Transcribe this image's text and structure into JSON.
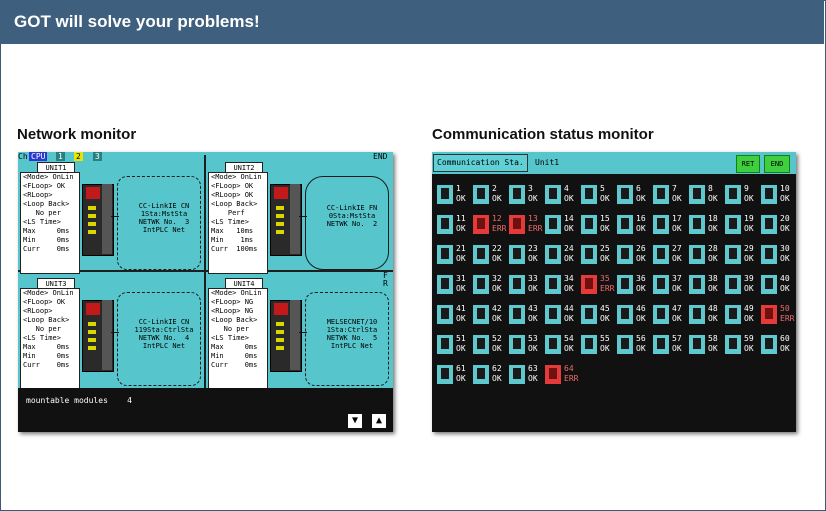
{
  "header": {
    "title": "GOT will solve your problems!"
  },
  "captions": {
    "network": "Network monitor",
    "comm": "Communication status monitor"
  },
  "network_monitor": {
    "top_bar": {
      "ch": "Ch",
      "cpu": "CPU",
      "tabs": [
        "1",
        "2",
        "3"
      ],
      "end": "END"
    },
    "units": [
      {
        "name": "UNIT1",
        "status": [
          "<Mode> OnLin",
          "<FLoop> OK",
          "<RLoop>",
          "<Loop Back>",
          "   No per",
          "<LS Time>",
          "Max     0ms",
          "Min     0ms",
          "Curr    0ms"
        ],
        "net": "CC-LinkIE CN\n1Sta:MstSta\nNETWK No.  3\nIntPLC Net"
      },
      {
        "name": "UNIT2",
        "status": [
          "<Mode> OnLin",
          "<FLoop> OK",
          "<RLoop> OK",
          "<Loop Back>",
          "    Perf",
          "<LS Time>",
          "Max   10ms",
          "Min    1ms",
          "Curr  100ms"
        ],
        "net": "CC-LinkIE FN\n0Sta:MstSta\nNETWK No.  2"
      },
      {
        "name": "UNIT3",
        "status": [
          "<Mode> OnLin",
          "<FLoop> OK",
          "<RLoop>",
          "<Loop Back>",
          "   No per",
          "<LS Time>",
          "Max     0ms",
          "Min     0ms",
          "Curr    0ms"
        ],
        "net": "CC-LinkIE CN\n119Sta:CtrlSta\nNETWK No.  4\nIntPLC Net"
      },
      {
        "name": "UNIT4",
        "status": [
          "<Mode> OnLin",
          "<FLoop> NG",
          "<RLoop> NG",
          "<Loop Back>",
          "   No per",
          "<LS Time>",
          "Max     0ms",
          "Min     0ms",
          "Curr    0ms"
        ],
        "net": "MELSECNET/10\n1Sta:CtrlSta\nNETWK No.  5\nIntPLC Net",
        "flags": "F\nR"
      }
    ],
    "footer": {
      "mountable": "mountable modules    4",
      "down": "▼",
      "up": "▲"
    }
  },
  "comm_monitor": {
    "title": "Communication Sta.",
    "unit": "Unit1",
    "ret": "RET",
    "end": "END",
    "stations": [
      {
        "n": "1",
        "s": "OK"
      },
      {
        "n": "2",
        "s": "OK"
      },
      {
        "n": "3",
        "s": "OK"
      },
      {
        "n": "4",
        "s": "OK"
      },
      {
        "n": "5",
        "s": "OK"
      },
      {
        "n": "6",
        "s": "OK"
      },
      {
        "n": "7",
        "s": "OK"
      },
      {
        "n": "8",
        "s": "OK"
      },
      {
        "n": "9",
        "s": "OK"
      },
      {
        "n": "10",
        "s": "OK"
      },
      {
        "n": "11",
        "s": "OK"
      },
      {
        "n": "12",
        "s": "ERR"
      },
      {
        "n": "13",
        "s": "ERR"
      },
      {
        "n": "14",
        "s": "OK"
      },
      {
        "n": "15",
        "s": "OK"
      },
      {
        "n": "16",
        "s": "OK"
      },
      {
        "n": "17",
        "s": "OK"
      },
      {
        "n": "18",
        "s": "OK"
      },
      {
        "n": "19",
        "s": "OK"
      },
      {
        "n": "20",
        "s": "OK"
      },
      {
        "n": "21",
        "s": "OK"
      },
      {
        "n": "22",
        "s": "OK"
      },
      {
        "n": "23",
        "s": "OK"
      },
      {
        "n": "24",
        "s": "OK"
      },
      {
        "n": "25",
        "s": "OK"
      },
      {
        "n": "26",
        "s": "OK"
      },
      {
        "n": "27",
        "s": "OK"
      },
      {
        "n": "28",
        "s": "OK"
      },
      {
        "n": "29",
        "s": "OK"
      },
      {
        "n": "30",
        "s": "OK"
      },
      {
        "n": "31",
        "s": "OK"
      },
      {
        "n": "32",
        "s": "OK"
      },
      {
        "n": "33",
        "s": "OK"
      },
      {
        "n": "34",
        "s": "OK"
      },
      {
        "n": "35",
        "s": "ERR"
      },
      {
        "n": "36",
        "s": "OK"
      },
      {
        "n": "37",
        "s": "OK"
      },
      {
        "n": "38",
        "s": "OK"
      },
      {
        "n": "39",
        "s": "OK"
      },
      {
        "n": "40",
        "s": "OK"
      },
      {
        "n": "41",
        "s": "OK"
      },
      {
        "n": "42",
        "s": "OK"
      },
      {
        "n": "43",
        "s": "OK"
      },
      {
        "n": "44",
        "s": "OK"
      },
      {
        "n": "45",
        "s": "OK"
      },
      {
        "n": "46",
        "s": "OK"
      },
      {
        "n": "47",
        "s": "OK"
      },
      {
        "n": "48",
        "s": "OK"
      },
      {
        "n": "49",
        "s": "OK"
      },
      {
        "n": "50",
        "s": "ERR"
      },
      {
        "n": "51",
        "s": "OK"
      },
      {
        "n": "52",
        "s": "OK"
      },
      {
        "n": "53",
        "s": "OK"
      },
      {
        "n": "54",
        "s": "OK"
      },
      {
        "n": "55",
        "s": "OK"
      },
      {
        "n": "56",
        "s": "OK"
      },
      {
        "n": "57",
        "s": "OK"
      },
      {
        "n": "58",
        "s": "OK"
      },
      {
        "n": "59",
        "s": "OK"
      },
      {
        "n": "60",
        "s": "OK"
      },
      {
        "n": "61",
        "s": "OK"
      },
      {
        "n": "62",
        "s": "OK"
      },
      {
        "n": "63",
        "s": "OK"
      },
      {
        "n": "64",
        "s": "ERR"
      }
    ]
  },
  "colors": {
    "header_bg": "#3f5f7e",
    "screen_cyan": "#56c6cc",
    "ok_icon": "#5fc8cf",
    "err_icon": "#e43a3a",
    "button_green": "#3ecf3e"
  }
}
